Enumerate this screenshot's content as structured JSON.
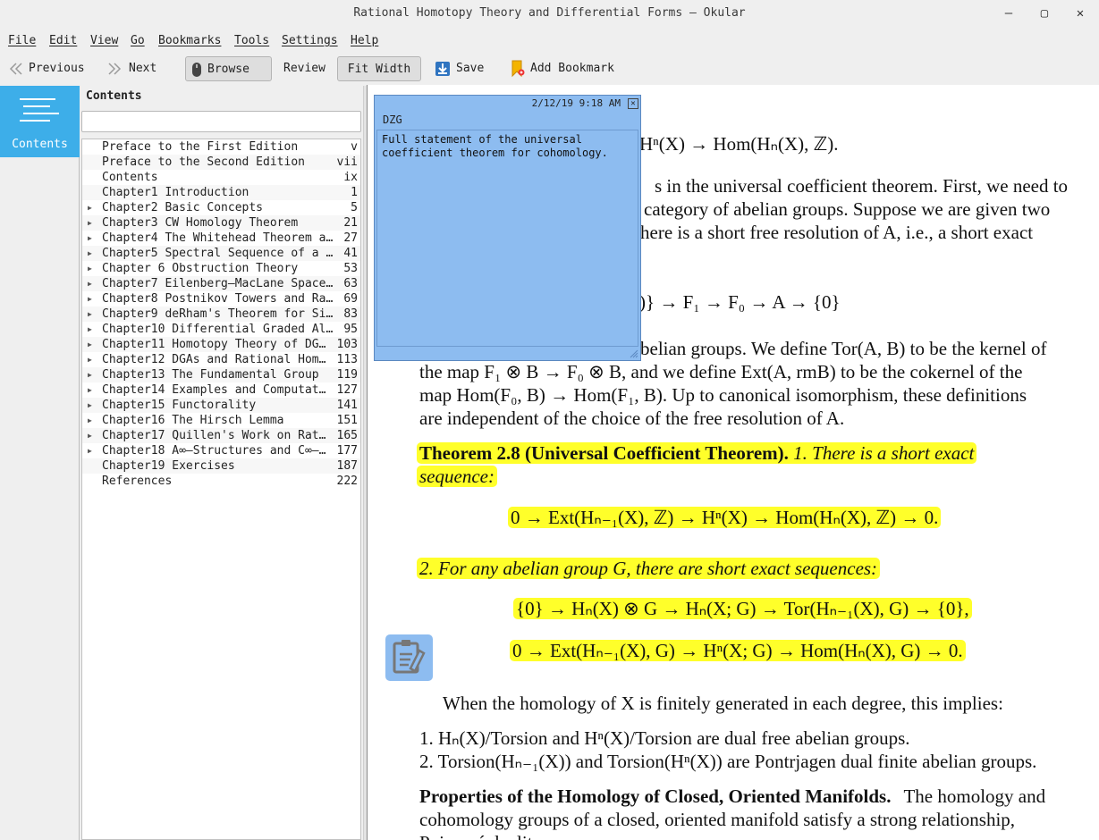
{
  "window": {
    "title": "Rational Homotopy Theory and Differential Forms  — Okular",
    "buttons": {
      "minimize": "—",
      "maximize": "▢",
      "close": "✕"
    }
  },
  "menu": [
    "File",
    "Edit",
    "View",
    "Go",
    "Bookmarks",
    "Tools",
    "Settings",
    "Help"
  ],
  "toolbar": {
    "previous": "Previous",
    "next": "Next",
    "browse": "Browse",
    "review": "Review",
    "fit_width": "Fit Width",
    "save": "Save",
    "add_bookmark": "Add Bookmark"
  },
  "sidebar": {
    "contents_label": "Contents"
  },
  "toc": {
    "title": "Contents",
    "search_placeholder": "",
    "items": [
      {
        "label": "Preface to the First Edition",
        "page": "v",
        "expandable": false
      },
      {
        "label": "Preface to the Second Edition",
        "page": "vii",
        "expandable": false
      },
      {
        "label": "Contents",
        "page": "ix",
        "expandable": false
      },
      {
        "label": "Chapter1 Introduction",
        "page": "1",
        "expandable": false
      },
      {
        "label": "Chapter2 Basic Concepts",
        "page": "5",
        "expandable": true
      },
      {
        "label": "Chapter3 CW Homology Theorem",
        "page": "21",
        "expandable": true
      },
      {
        "label": "Chapter4 The Whitehead Theorem a…",
        "page": "27",
        "expandable": true
      },
      {
        "label": "Chapter5 Spectral Sequence of a …",
        "page": "41",
        "expandable": true
      },
      {
        "label": "Chapter 6 Obstruction Theory",
        "page": "53",
        "expandable": true
      },
      {
        "label": "Chapter7 Eilenberg–MacLane Space…",
        "page": "63",
        "expandable": true
      },
      {
        "label": "Chapter8 Postnikov Towers and Ra…",
        "page": "69",
        "expandable": true
      },
      {
        "label": "Chapter9 deRham's Theorem for Si…",
        "page": "83",
        "expandable": true
      },
      {
        "label": "Chapter10 Differential Graded Al…",
        "page": "95",
        "expandable": true
      },
      {
        "label": "Chapter11 Homotopy Theory of DG…",
        "page": "103",
        "expandable": true
      },
      {
        "label": "Chapter12 DGAs and Rational Hom…",
        "page": "113",
        "expandable": true
      },
      {
        "label": "Chapter13 The Fundamental Group",
        "page": "119",
        "expandable": true
      },
      {
        "label": "Chapter14 Examples and Computat…",
        "page": "127",
        "expandable": true
      },
      {
        "label": "Chapter15 Functorality",
        "page": "141",
        "expandable": true
      },
      {
        "label": "Chapter16 The Hirsch Lemma",
        "page": "151",
        "expandable": true
      },
      {
        "label": "Chapter17 Quillen's Work on Rat…",
        "page": "165",
        "expandable": true
      },
      {
        "label": "Chapter18 A∞–Structures and C∞–…",
        "page": "177",
        "expandable": true
      },
      {
        "label": "Chapter19 Exercises",
        "page": "187",
        "expandable": false
      },
      {
        "label": "References",
        "page": "222",
        "expandable": false
      }
    ]
  },
  "annotation": {
    "date": "2/12/19 9:18 AM",
    "author": "DZG",
    "text": "Full statement of the universal coefficient theorem for cohomology.",
    "color": "#8dbcf0"
  },
  "document": {
    "line1_tail": "Hⁿ(X) → Hom(Hₙ(X), ℤ).",
    "para1": [
      "s in the universal coefficient theorem. First, we need to",
      "category of abelian groups. Suppose we are given two",
      "here is a short free resolution of A, i.e., a short exact"
    ],
    "seq1_tail": ")} → F₁ → F₀ → A → {0}",
    "para2": [
      "belian groups. We define Tor(A, B) to be the kernel of",
      "the map F₁ ⊗ B → F₀ ⊗ B, and we define Ext(A, rmB) to be the cokernel of the",
      "map Hom(F₀, B) → Hom(F₁, B). Up to canonical isomorphism, these definitions",
      "are independent of the choice of the free resolution of A."
    ],
    "theorem_head": "Theorem 2.8 (Universal Coefficient Theorem).",
    "theorem_first": "1. There is a short exact",
    "theorem_second": "sequence:",
    "eq1": "0 → Ext(Hₙ₋₁(X), ℤ) → Hⁿ(X) → Hom(Hₙ(X), ℤ) → 0.",
    "item2": "2. For any abelian group G, there are short exact sequences:",
    "eq2": "{0} → Hₙ(X) ⊗ G → Hₙ(X; G) → Tor(Hₙ₋₁(X), G) → {0},",
    "eq3": "0 → Ext(Hₙ₋₁(X), G) → Hⁿ(X; G) → Hom(Hₙ(X), G) → 0.",
    "implies": "When the homology of X is finitely generated in each degree, this implies:",
    "list": [
      "1. Hₙ(X)/Torsion and Hⁿ(X)/Torsion are dual free abelian groups.",
      "2. Torsion(Hₙ₋₁(X)) and Torsion(Hⁿ(X)) are Pontrjagen dual finite abelian groups."
    ],
    "prop_head": "Properties of the Homology of Closed, Oriented Manifolds.",
    "prop_line1": "The homology and",
    "prop_line2": "cohomology groups of a closed, oriented manifold satisfy a strong relationship,",
    "prop_line3": "Poincaré duality."
  },
  "colors": {
    "accent": "#3daee9",
    "highlight": "#ffff2a",
    "popup": "#8dbcf0"
  }
}
